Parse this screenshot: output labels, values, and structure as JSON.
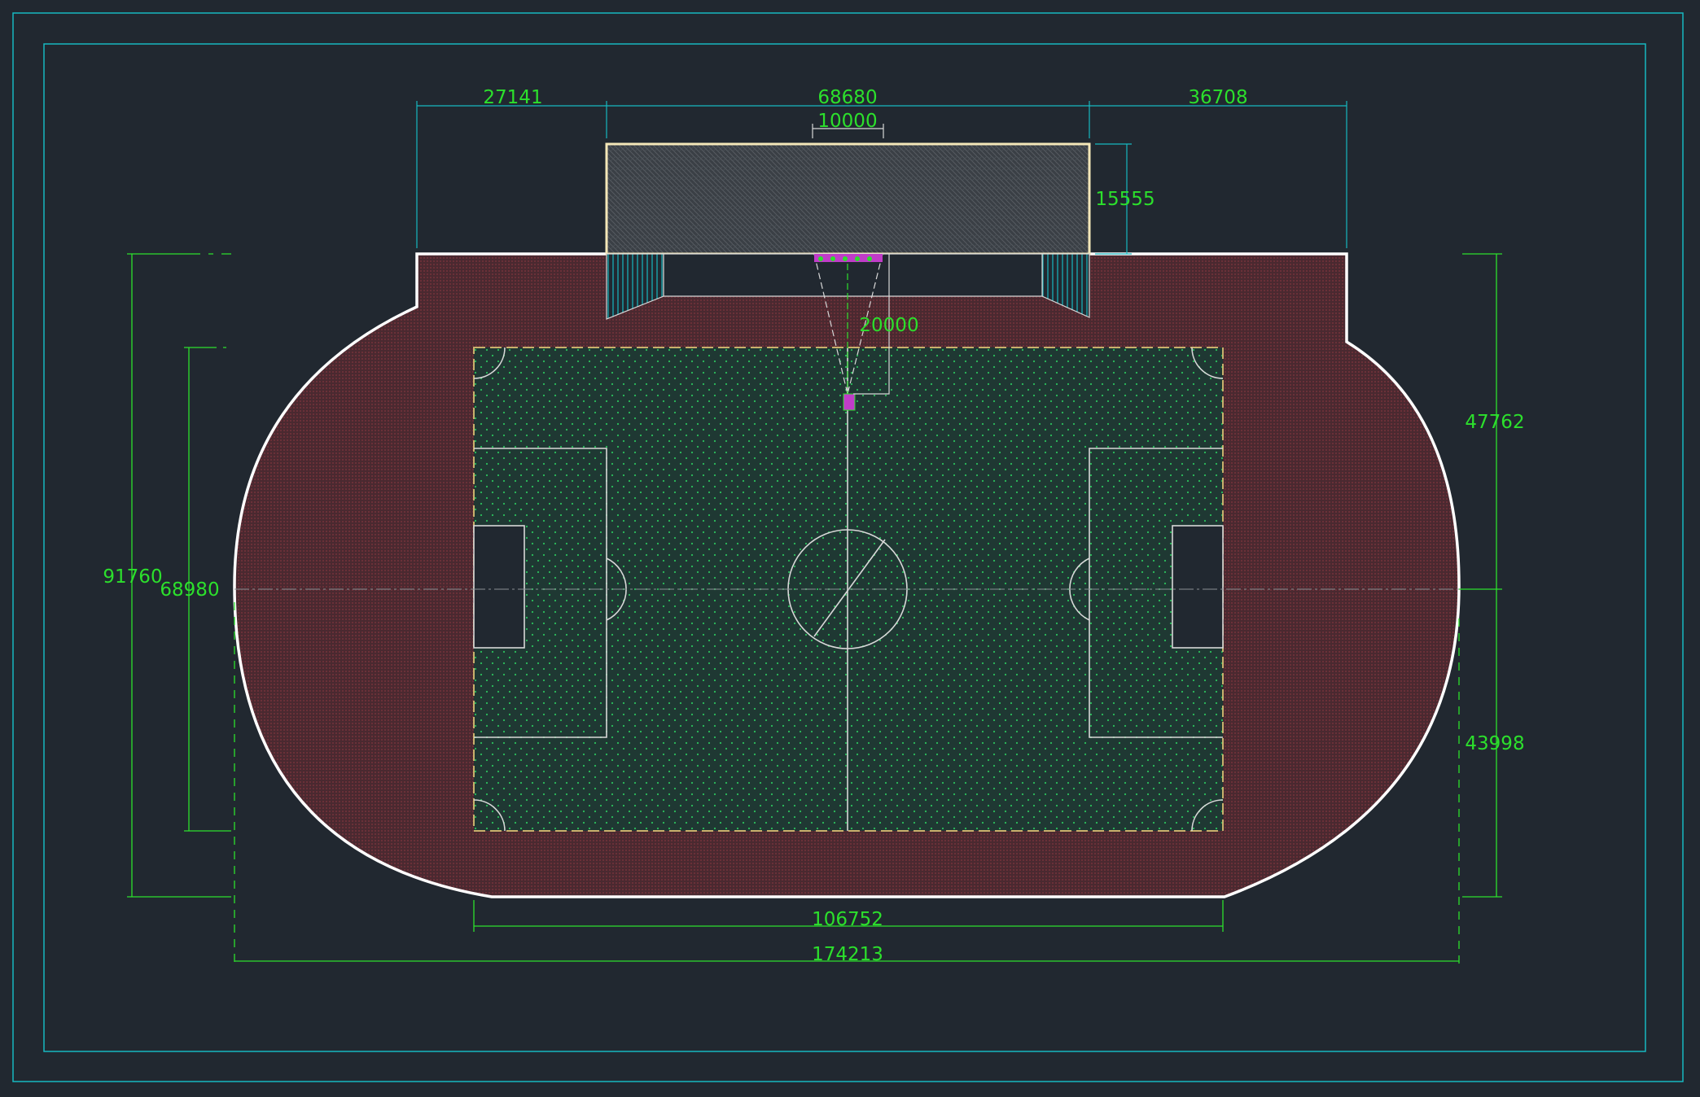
{
  "colors": {
    "background": "#212830",
    "frame": "#17b8c0",
    "dimension": "#2ce02c",
    "track": "#4d2a30",
    "track_edge": "#ffffff",
    "field": "#1f3a35",
    "field_dot": "#2bbf5c",
    "boundary": "#c8b06c",
    "stand_fill": "#3a3f45",
    "stand_edge": "#f4e7b8",
    "field_line": "#d8d8d8"
  },
  "dimensions": {
    "top_left": "27141",
    "top_middle": "68680",
    "top_right": "36708",
    "stand_section": "10000",
    "stand_depth": "15555",
    "camera_distance": "20000",
    "overall_height": "91760",
    "field_height": "68980",
    "upper_half": "47762",
    "lower_half": "43998",
    "field_length": "106752",
    "overall_length": "174213"
  },
  "icons": {
    "stand": "seating-block-icon",
    "camera": "camera-position-icon",
    "center": "center-circle-icon"
  }
}
